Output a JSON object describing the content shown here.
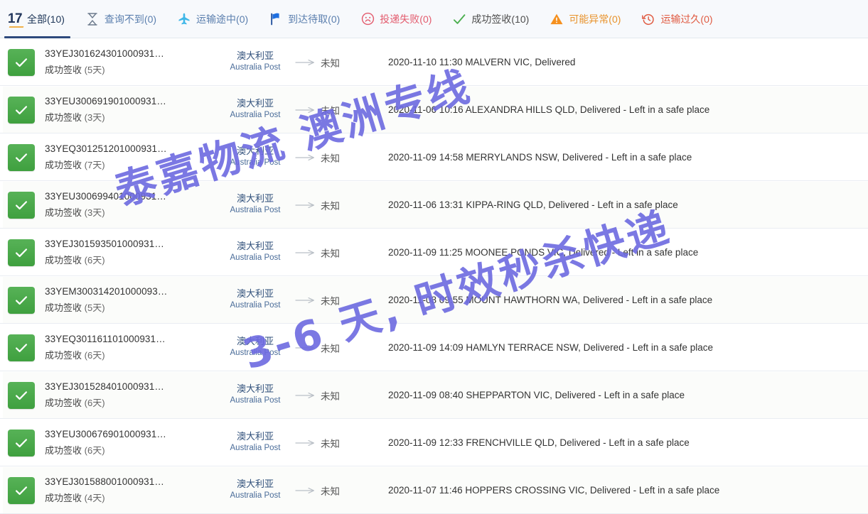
{
  "tabs": [
    {
      "label": "全部(10)",
      "icon": "badge-17-icon",
      "state": "all",
      "active": true
    },
    {
      "label": "查询不到(0)",
      "icon": "hourglass-icon",
      "state": "notfound",
      "active": false
    },
    {
      "label": "运输途中(0)",
      "icon": "airplane-icon",
      "state": "transit",
      "active": false
    },
    {
      "label": "到达待取(0)",
      "icon": "flag-icon",
      "state": "pickup",
      "active": false
    },
    {
      "label": "投递失败(0)",
      "icon": "sad-face-icon",
      "state": "failed",
      "active": false
    },
    {
      "label": "成功签收(10)",
      "icon": "check-icon",
      "state": "delivered",
      "active": false
    },
    {
      "label": "可能异常(0)",
      "icon": "warning-triangle-icon",
      "state": "exception",
      "active": false
    },
    {
      "label": "运输过久(0)",
      "icon": "clock-back-icon",
      "state": "slow",
      "active": false
    }
  ],
  "tab_badge": "17",
  "carrier": {
    "cn": "澳大利亚",
    "en": "Australia Post"
  },
  "destination_unknown": "未知",
  "rows": [
    {
      "tracking": "33YEJ301624301000931…",
      "status": "成功签收",
      "days": "(5天)",
      "event": "2020-11-10 11:30  MALVERN VIC, Delivered"
    },
    {
      "tracking": "33YEU300691901000931…",
      "status": "成功签收",
      "days": "(3天)",
      "event": "2020-11-06 10:16  ALEXANDRA HILLS QLD, Delivered - Left in a safe place"
    },
    {
      "tracking": "33YEQ301251201000931…",
      "status": "成功签收",
      "days": "(7天)",
      "event": "2020-11-09 14:58  MERRYLANDS NSW, Delivered - Left in a safe place"
    },
    {
      "tracking": "33YEU300699401000931…",
      "status": "成功签收",
      "days": "(3天)",
      "event": "2020-11-06 13:31  KIPPA-RING QLD, Delivered - Left in a safe place"
    },
    {
      "tracking": "33YEJ301593501000931…",
      "status": "成功签收",
      "days": "(6天)",
      "event": "2020-11-09 11:25  MOONEE PONDS VIC, Delivered - Left in a safe place"
    },
    {
      "tracking": "33YEM300314201000093…",
      "status": "成功签收",
      "days": "(5天)",
      "event": "2020-11-08 09:55  MOUNT HAWTHORN WA, Delivered - Left in a safe place"
    },
    {
      "tracking": "33YEQ301161101000931…",
      "status": "成功签收",
      "days": "(6天)",
      "event": "2020-11-09 14:09  HAMLYN TERRACE NSW, Delivered - Left in a safe place"
    },
    {
      "tracking": "33YEJ301528401000931…",
      "status": "成功签收",
      "days": "(6天)",
      "event": "2020-11-09 08:40  SHEPPARTON VIC, Delivered - Left in a safe place"
    },
    {
      "tracking": "33YEU300676901000931…",
      "status": "成功签收",
      "days": "(6天)",
      "event": "2020-11-09 12:33  FRENCHVILLE QLD, Delivered - Left in a safe place"
    },
    {
      "tracking": "33YEJ301588001000931…",
      "status": "成功签收",
      "days": "(4天)",
      "event": "2020-11-07 11:46  HOPPERS CROSSING VIC, Delivered - Left in a safe place"
    }
  ],
  "watermarks": {
    "line1": "泰嘉物流 澳洲专线",
    "line2": "3-6 天,   时效秒杀快递",
    "color": "#6d6ae0"
  }
}
